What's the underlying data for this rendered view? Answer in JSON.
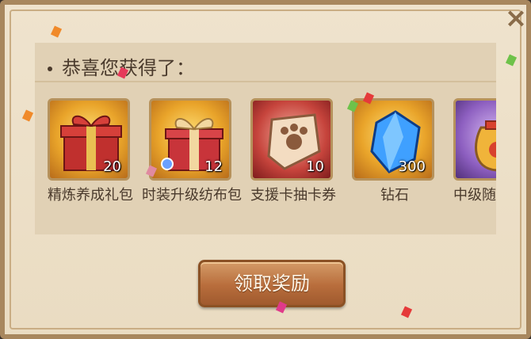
{
  "dialog": {
    "title": "恭喜您获得了：",
    "close_icon": "close-icon",
    "claim_button_label": "领取奖励"
  },
  "rewards": [
    {
      "name": "精炼养成礼包",
      "qty": "20",
      "icon": "gift-box-icon",
      "frame": "gold"
    },
    {
      "name": "时装升级纺布包",
      "qty": "12",
      "icon": "gift-box-icon",
      "frame": "gold"
    },
    {
      "name": "支援卡抽卡券",
      "qty": "10",
      "icon": "paw-ticket-icon",
      "frame": "red"
    },
    {
      "name": "钻石",
      "qty": "300",
      "icon": "diamond-icon",
      "frame": "gold"
    },
    {
      "name": "中级随机宝袋",
      "qty": "",
      "icon": "treasure-bag-icon",
      "frame": "purple"
    }
  ],
  "colors": {
    "panel": "#efe3cd",
    "button": "#b86d3c",
    "text": "#4a3a2c"
  }
}
